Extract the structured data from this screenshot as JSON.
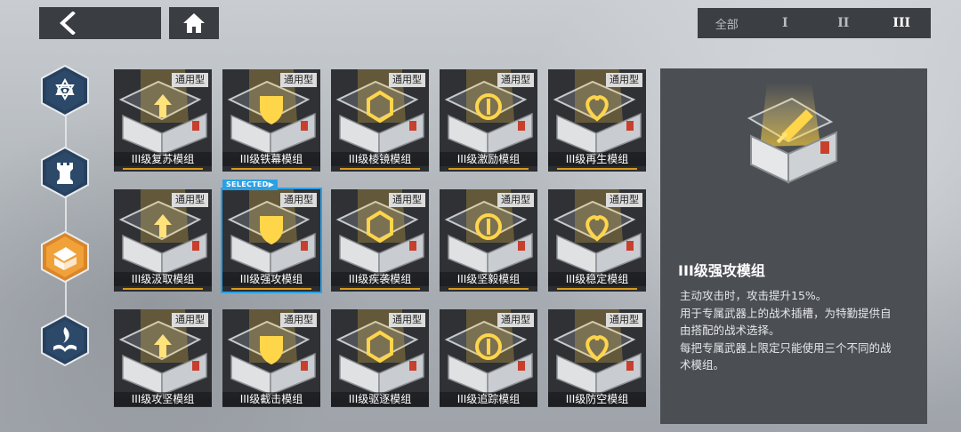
{
  "nav": {
    "back_icon": "chevron-left-icon",
    "home_icon": "home-icon"
  },
  "tiers": [
    {
      "label": "全部",
      "active": false
    },
    {
      "label": "I",
      "active": false
    },
    {
      "label": "II",
      "active": false
    },
    {
      "label": "III",
      "active": true
    }
  ],
  "categories": [
    {
      "icon": "star-eye-icon",
      "active": false
    },
    {
      "icon": "rook-icon",
      "active": false
    },
    {
      "icon": "module-case-icon",
      "active": true
    },
    {
      "icon": "flame-book-icon",
      "active": false
    }
  ],
  "modules": [
    {
      "name": "III级复苏模组",
      "tag": "通用型",
      "selected": false
    },
    {
      "name": "III级铁幕模组",
      "tag": "通用型",
      "selected": false
    },
    {
      "name": "III级棱镜模组",
      "tag": "通用型",
      "selected": false
    },
    {
      "name": "III级激励模组",
      "tag": "通用型",
      "selected": false
    },
    {
      "name": "III级再生模组",
      "tag": "通用型",
      "selected": false
    },
    {
      "name": "III级汲取模组",
      "tag": "通用型",
      "selected": false
    },
    {
      "name": "III级强攻模组",
      "tag": "通用型",
      "selected": true
    },
    {
      "name": "III级疾袭模组",
      "tag": "通用型",
      "selected": false
    },
    {
      "name": "III级坚毅模组",
      "tag": "通用型",
      "selected": false
    },
    {
      "name": "III级稳定模组",
      "tag": "通用型",
      "selected": false
    },
    {
      "name": "III级攻坚模组",
      "tag": "通用型",
      "selected": false
    },
    {
      "name": "III级截击模组",
      "tag": "通用型",
      "selected": false
    },
    {
      "name": "III级驱逐模组",
      "tag": "通用型",
      "selected": false
    },
    {
      "name": "III级追踪模组",
      "tag": "通用型",
      "selected": false
    },
    {
      "name": "III级防空模组",
      "tag": "通用型",
      "selected": false
    }
  ],
  "selected_label": "SELECTED▶",
  "detail": {
    "title": "III级强攻模组",
    "lines": [
      "主动攻击时，攻击提升15%。",
      "用于专属武器上的战术插槽，为特勤提供自",
      "由搭配的战术选择。",
      "每把专属武器上限定只能使用三个不同的战",
      "术模组。"
    ]
  },
  "colors": {
    "accent_gold": "#d89a1c",
    "selected_blue": "#2aa0e6",
    "active_category": "#f2a43a",
    "panel_dark": "#3a3d42"
  }
}
